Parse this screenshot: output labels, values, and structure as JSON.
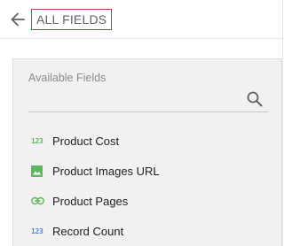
{
  "header": {
    "title": "ALL FIELDS",
    "back_icon": "arrow-left-icon"
  },
  "panel": {
    "label": "Available Fields",
    "search": {
      "value": "",
      "placeholder": ""
    },
    "search_icon": "search-icon"
  },
  "fields": [
    {
      "label": "Product Cost",
      "icon": "number-icon",
      "icon_text": "123",
      "icon_color": "#5cb85c"
    },
    {
      "label": "Product Images URL",
      "icon": "image-icon",
      "icon_color": "#5cb85c"
    },
    {
      "label": "Product Pages",
      "icon": "link-icon",
      "icon_color": "#5cb85c"
    },
    {
      "label": "Record Count",
      "icon": "number-icon",
      "icon_text": "123",
      "icon_color": "#4a86e8"
    }
  ]
}
